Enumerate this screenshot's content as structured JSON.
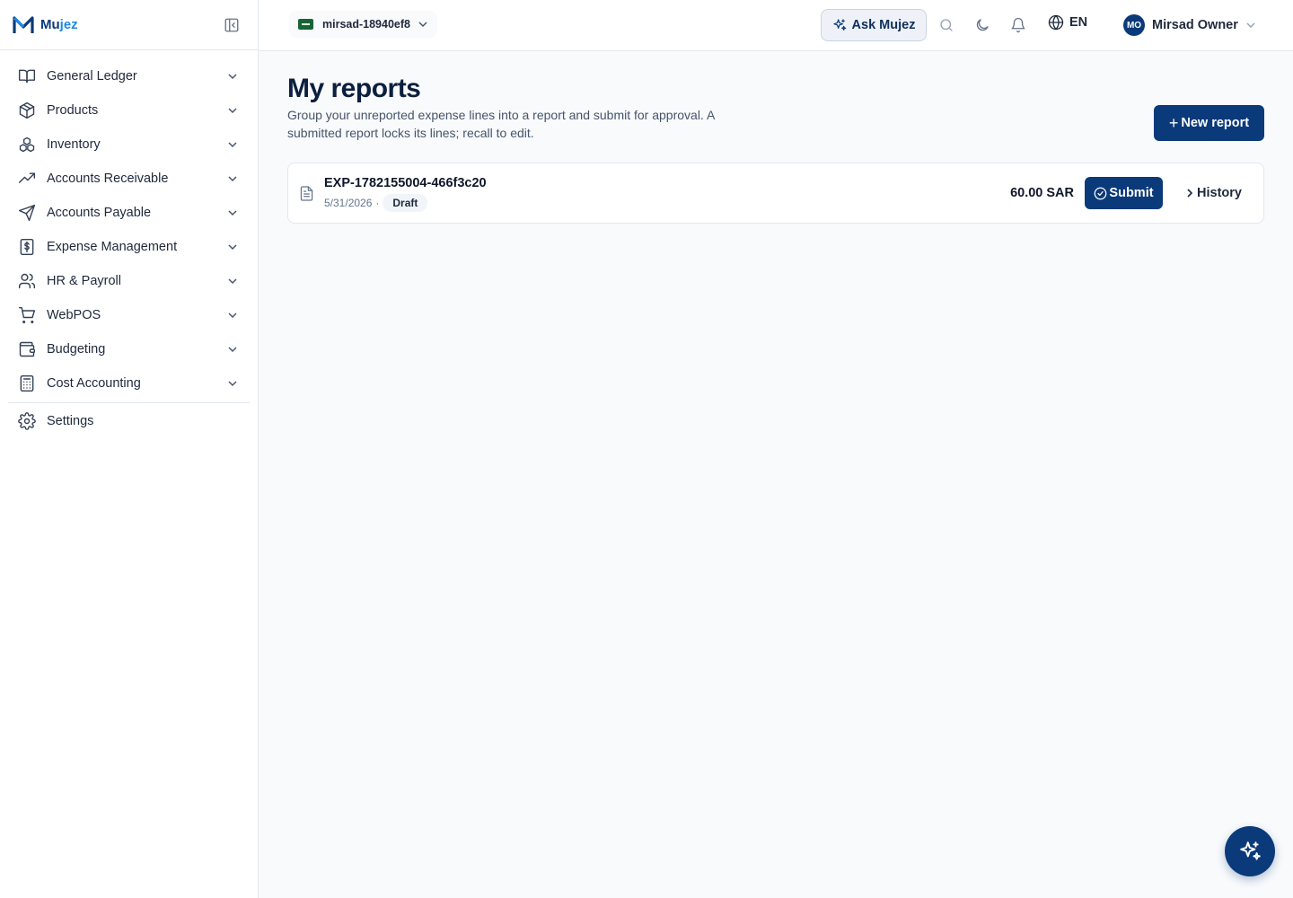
{
  "brand": {
    "name_main": "Mu",
    "name_accent": "jez"
  },
  "sidebar": {
    "items": [
      {
        "label": "General Ledger",
        "icon": "book-open-icon"
      },
      {
        "label": "Products",
        "icon": "package-icon"
      },
      {
        "label": "Inventory",
        "icon": "boxes-icon"
      },
      {
        "label": "Accounts Receivable",
        "icon": "trending-up-icon"
      },
      {
        "label": "Accounts Payable",
        "icon": "send-icon"
      },
      {
        "label": "Expense Management",
        "icon": "receipt-icon"
      },
      {
        "label": "HR & Payroll",
        "icon": "users-icon"
      },
      {
        "label": "WebPOS",
        "icon": "shopping-cart-icon"
      },
      {
        "label": "Budgeting",
        "icon": "wallet-icon"
      },
      {
        "label": "Cost Accounting",
        "icon": "calculator-icon"
      }
    ],
    "settings_label": "Settings"
  },
  "header": {
    "org_name": "mirsad-18940ef8",
    "ask_label": "Ask Mujez",
    "language": "EN",
    "user_initials": "MO",
    "user_name": "Mirsad Owner"
  },
  "main": {
    "title": "My reports",
    "subtitle": "Group your unreported expense lines into a report and submit for approval. A submitted report locks its lines; recall to edit.",
    "new_report_label": "New report",
    "reports": [
      {
        "id": "EXP-1782155004-466f3c20",
        "date": "5/31/2026",
        "status": "Draft",
        "amount": "60.00 SAR",
        "submit_label": "Submit",
        "history_label": "History"
      }
    ]
  },
  "colors": {
    "primary": "#0b3a7a",
    "accent": "#1e88e5",
    "background": "#f8fafc",
    "border": "#e2e8f0"
  }
}
